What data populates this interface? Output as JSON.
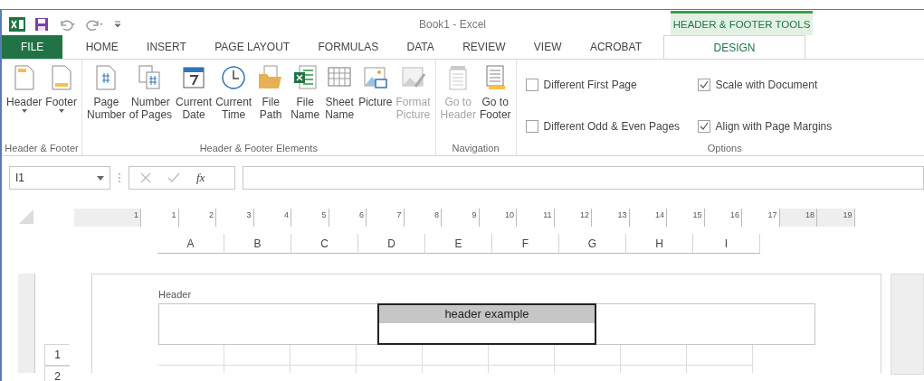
{
  "title_bar": {
    "title": "Book1 - Excel",
    "context_label": "HEADER & FOOTER TOOLS"
  },
  "tabs": [
    {
      "label": "FILE",
      "kind": "file",
      "selected": false
    },
    {
      "label": "HOME",
      "kind": "normal",
      "selected": false
    },
    {
      "label": "INSERT",
      "kind": "normal",
      "selected": false
    },
    {
      "label": "PAGE LAYOUT",
      "kind": "normal",
      "selected": false
    },
    {
      "label": "FORMULAS",
      "kind": "normal",
      "selected": false
    },
    {
      "label": "DATA",
      "kind": "normal",
      "selected": false
    },
    {
      "label": "REVIEW",
      "kind": "normal",
      "selected": false
    },
    {
      "label": "VIEW",
      "kind": "normal",
      "selected": false
    },
    {
      "label": "ACROBAT",
      "kind": "normal",
      "selected": false
    },
    {
      "label": "DESIGN",
      "kind": "context",
      "selected": true
    }
  ],
  "ribbon": {
    "groups": [
      {
        "label": "Header & Footer",
        "buttons": [
          {
            "kind": "header",
            "lines": [
              "Header"
            ],
            "dropdown": true,
            "disabled": false
          },
          {
            "kind": "footer",
            "lines": [
              "Footer"
            ],
            "dropdown": true,
            "disabled": false
          }
        ]
      },
      {
        "label": "Header & Footer Elements",
        "buttons": [
          {
            "kind": "page-number",
            "lines": [
              "Page",
              "Number"
            ],
            "dropdown": false,
            "disabled": false
          },
          {
            "kind": "pages",
            "lines": [
              "Number",
              "of Pages"
            ],
            "dropdown": false,
            "disabled": false
          },
          {
            "kind": "date",
            "lines": [
              "Current",
              "Date"
            ],
            "dropdown": false,
            "disabled": false
          },
          {
            "kind": "time",
            "lines": [
              "Current",
              "Time"
            ],
            "dropdown": false,
            "disabled": false
          },
          {
            "kind": "path",
            "lines": [
              "File",
              "Path"
            ],
            "dropdown": false,
            "disabled": false
          },
          {
            "kind": "file-name",
            "lines": [
              "File",
              "Name"
            ],
            "dropdown": false,
            "disabled": false
          },
          {
            "kind": "sheet",
            "lines": [
              "Sheet",
              "Name"
            ],
            "dropdown": false,
            "disabled": false
          },
          {
            "kind": "picture",
            "lines": [
              "Picture"
            ],
            "dropdown": false,
            "disabled": false
          },
          {
            "kind": "format-picture",
            "lines": [
              "Format",
              "Picture"
            ],
            "dropdown": false,
            "disabled": true
          }
        ]
      },
      {
        "label": "Navigation",
        "buttons": [
          {
            "kind": "go-header",
            "lines": [
              "Go to",
              "Header"
            ],
            "dropdown": false,
            "disabled": true
          },
          {
            "kind": "go-footer",
            "lines": [
              "Go to",
              "Footer"
            ],
            "dropdown": false,
            "disabled": false
          }
        ]
      }
    ],
    "options": {
      "label": "Options",
      "checkboxes": [
        {
          "label": "Different First Page",
          "checked": false
        },
        {
          "label": "Scale with Document",
          "checked": true
        },
        {
          "label": "Different Odd & Even Pages",
          "checked": false
        },
        {
          "label": "Align with Page Margins",
          "checked": true
        }
      ]
    }
  },
  "formula_bar": {
    "name_box": "I1",
    "function_label": "fx"
  },
  "ruler": [
    {
      "label": "1",
      "margin": true
    },
    {
      "label": "1",
      "margin": false
    },
    {
      "label": "2",
      "margin": false
    },
    {
      "label": "3",
      "margin": false
    },
    {
      "label": "4",
      "margin": false
    },
    {
      "label": "5",
      "margin": false
    },
    {
      "label": "6",
      "margin": false
    },
    {
      "label": "7",
      "margin": false
    },
    {
      "label": "8",
      "margin": false
    },
    {
      "label": "9",
      "margin": false
    },
    {
      "label": "10",
      "margin": false
    },
    {
      "label": "11",
      "margin": false
    },
    {
      "label": "12",
      "margin": false
    },
    {
      "label": "13",
      "margin": false
    },
    {
      "label": "14",
      "margin": false
    },
    {
      "label": "15",
      "margin": false
    },
    {
      "label": "16",
      "margin": false
    },
    {
      "label": "17",
      "margin": false
    },
    {
      "label": "18",
      "margin": true
    },
    {
      "label": "19",
      "margin": true
    }
  ],
  "columns": [
    "A",
    "B",
    "C",
    "D",
    "E",
    "F",
    "G",
    "H",
    "I"
  ],
  "rows": [
    "1",
    "2"
  ],
  "page": {
    "header_label": "Header",
    "sections": [
      {
        "selected": false
      },
      {
        "text": "header example",
        "selected": true
      },
      {
        "selected": false
      }
    ]
  }
}
